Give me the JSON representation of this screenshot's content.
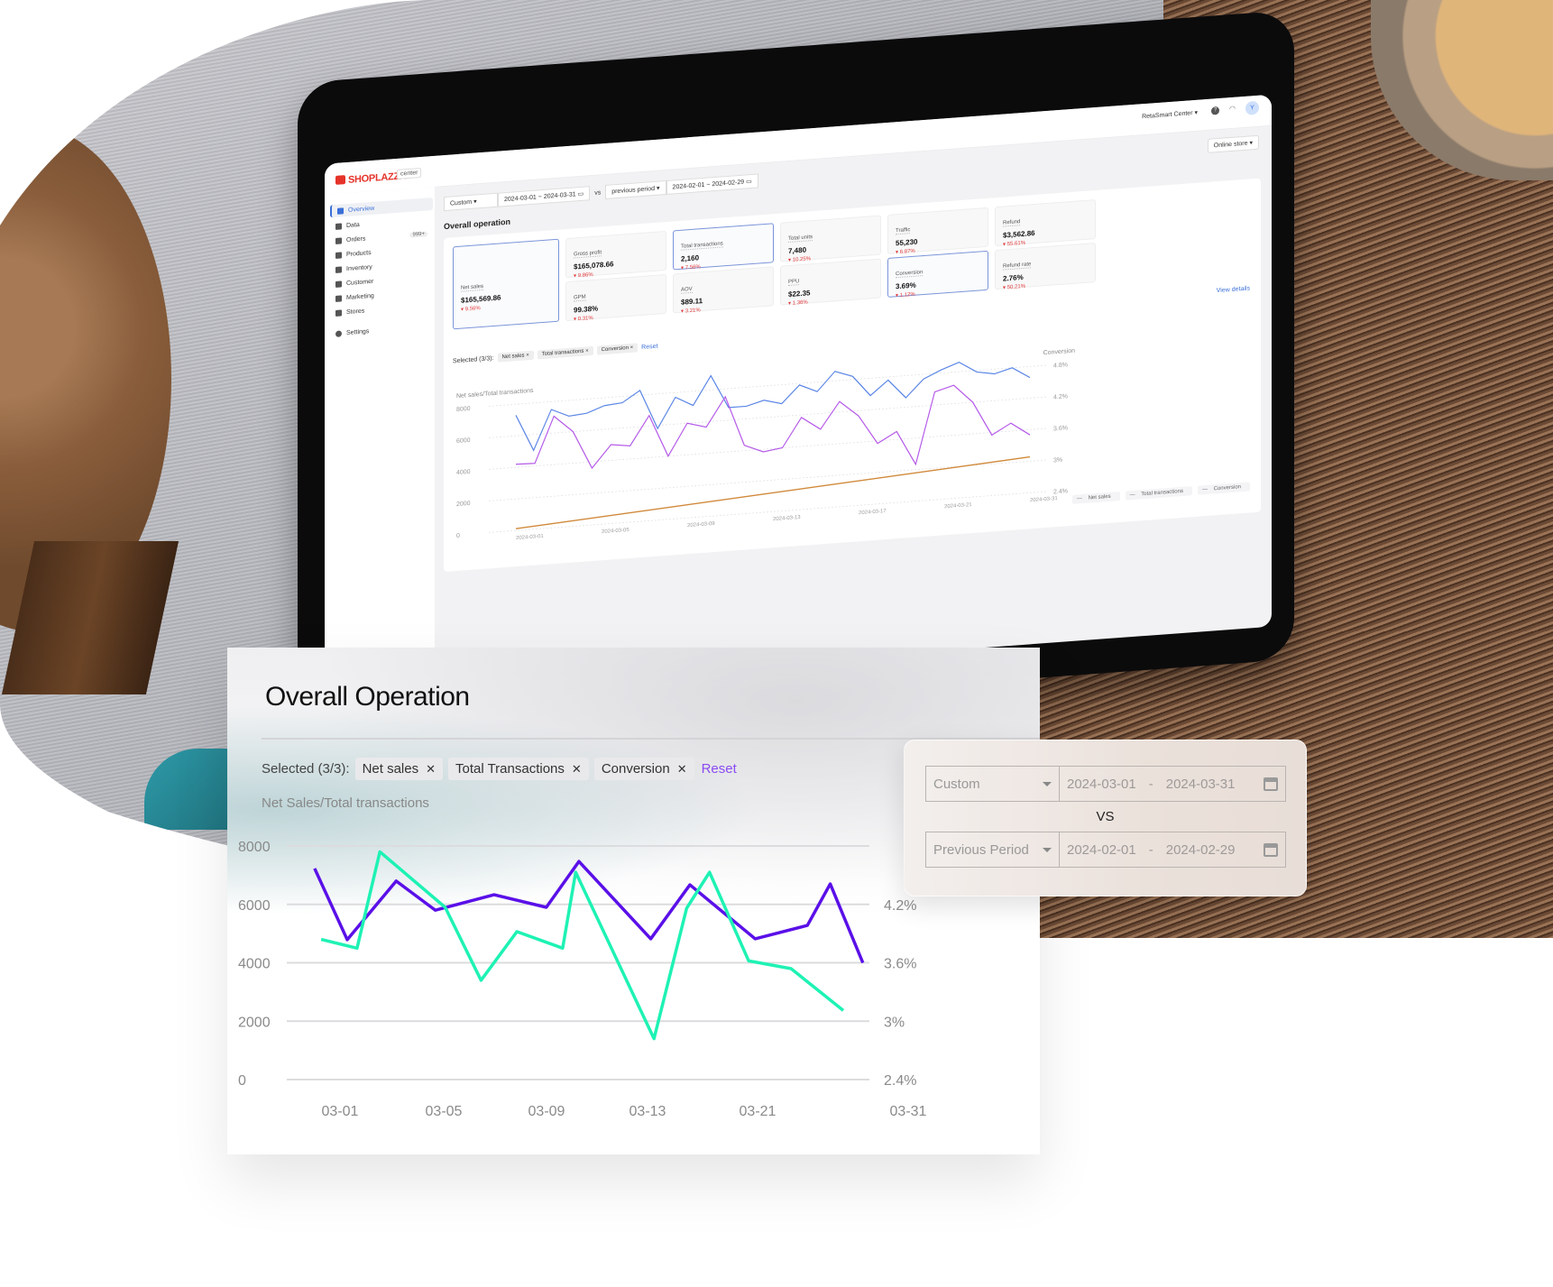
{
  "tablet": {
    "brand": "SHOPLAZZA",
    "brand_tag": "center",
    "store_name": "RetaSmart Center",
    "avatar_initial": "Y",
    "channel": "Online store",
    "sidebar": [
      {
        "label": "Overview",
        "icon": "home-icon",
        "active": true
      },
      {
        "label": "Data",
        "icon": "bar-chart-icon"
      },
      {
        "label": "Orders",
        "icon": "orders-icon",
        "badge": "999+"
      },
      {
        "label": "Products",
        "icon": "tag-icon"
      },
      {
        "label": "Inventory",
        "icon": "box-icon"
      },
      {
        "label": "Customer",
        "icon": "user-icon"
      },
      {
        "label": "Marketing",
        "icon": "marketing-icon"
      },
      {
        "label": "Stores",
        "icon": "store-icon"
      },
      {
        "label": "Settings",
        "icon": "gear-icon"
      }
    ],
    "filter": {
      "range_type": "Custom",
      "start": "2024-03-01",
      "end": "2024-03-31",
      "vs": "vs",
      "compare_type": "previous period",
      "compare_start": "2024-02-01",
      "compare_end": "2024-02-29",
      "sep": "~"
    },
    "section_title": "Overall operation",
    "metrics": [
      {
        "label": "Net sales",
        "value": "$165,569.86",
        "change": "9.56%"
      },
      {
        "label": "Gross profit",
        "value": "$165,078.66",
        "change": "9.86%"
      },
      {
        "label": "GPM",
        "value": "99.38%",
        "change": "0.31%"
      },
      {
        "label": "Total transactions",
        "value": "2,160",
        "change": "7.56%"
      },
      {
        "label": "AOV",
        "value": "$89.11",
        "change": "3.21%"
      },
      {
        "label": "Total units",
        "value": "7,480",
        "change": "10.25%"
      },
      {
        "label": "PPU",
        "value": "$22.35",
        "change": "1.36%"
      },
      {
        "label": "Traffic",
        "value": "55,230",
        "change": "6.87%"
      },
      {
        "label": "Conversion",
        "value": "3.69%",
        "change": "1.12%"
      },
      {
        "label": "Refund",
        "value": "$3,562.86",
        "change": "55.61%"
      },
      {
        "label": "Refund rate",
        "value": "2.76%",
        "change": "50.21%"
      }
    ],
    "view_details": "View details",
    "selected_label": "Selected (3/3):",
    "chips": [
      "Net sales",
      "Total transactions",
      "Conversion"
    ],
    "reset": "Reset",
    "chart_ytitle_left": "Net sales/Total transactions",
    "chart_ytitle_right": "Conversion",
    "y_left_ticks": [
      "8000",
      "6000",
      "4000",
      "2000",
      "0"
    ],
    "y_right_ticks": [
      "4.8%",
      "4.2%",
      "3.6%",
      "3%",
      "2.4%"
    ],
    "x_ticks": [
      "2024-03-01",
      "2024-03-05",
      "2024-03-09",
      "2024-03-13",
      "2024-03-17",
      "2024-03-21",
      "2024-03-31"
    ],
    "legend": [
      "Net sales",
      "Total transactions",
      "Conversion"
    ],
    "series_colors": {
      "net_sales": "#5b86e5",
      "total_transactions": "#d0893a",
      "conversion": "#b55ae8"
    },
    "net_sales": [
      7300,
      5000,
      7500,
      7000,
      7100,
      7500,
      7600,
      8300,
      5800,
      7700,
      7100,
      8900,
      6800,
      6800,
      7100,
      6800,
      7900,
      7400,
      8600,
      8200,
      6900,
      7800,
      6600,
      7700,
      8200,
      8600,
      7900,
      7700,
      8000,
      7300
    ],
    "conversion": [
      3.66,
      3.65,
      4.52,
      4.2,
      3.48,
      3.9,
      3.85,
      4.4,
      3.6,
      4.2,
      4.1,
      4.65,
      3.7,
      3.55,
      3.6,
      4.15,
      3.9,
      4.4,
      4.1,
      3.55,
      3.75,
      3.1,
      4.45,
      4.55,
      4.2,
      3.55,
      3.75,
      3.5
    ],
    "total_transactions": [
      0,
      2160
    ]
  },
  "card": {
    "title": "Overall Operation",
    "selected_label": "Selected (3/3):",
    "chips": [
      "Net sales",
      "Total Transactions",
      "Conversion"
    ],
    "reset": "Reset",
    "y_title": "Net Sales/Total transactions"
  },
  "date_panel": {
    "primary_type": "Custom",
    "primary_start": "2024-03-01",
    "primary_end": "2024-03-31",
    "vs": "VS",
    "compare_type": "Previous Period",
    "compare_start": "2024-02-01",
    "compare_end": "2024-02-29",
    "sep": "-"
  },
  "chart_data": {
    "type": "line",
    "title": "Overall Operation",
    "ylabel": "Net Sales/Total transactions",
    "y_left_range": [
      0,
      8000
    ],
    "y_left_ticks": [
      0,
      2000,
      4000,
      6000,
      8000
    ],
    "y_right_range": [
      2.4,
      4.8
    ],
    "y_right_ticks": [
      "2.4%",
      "3%",
      "3.6%",
      "4.2%"
    ],
    "x_ticks": [
      "03-01",
      "03-05",
      "03-09",
      "03-13",
      "03-21",
      "03-31"
    ],
    "grid": true,
    "series": [
      {
        "name": "Net sales",
        "color": "#5a10e8",
        "axis": "left",
        "x": [
          0,
          1,
          2.5,
          3.7,
          5.5,
          7.1,
          8.1,
          10.3,
          11.5,
          13.5,
          15.1,
          15.8,
          16.8
        ],
        "values": [
          7230,
          4790,
          6800,
          5800,
          6330,
          5900,
          7470,
          4820,
          6670,
          4820,
          5280,
          6700,
          4000
        ]
      },
      {
        "name": "Conversion",
        "color": "#1ef2b4",
        "axis": "right",
        "x": [
          0.2,
          1.3,
          2.0,
          4.0,
          5.1,
          6.2,
          7.6,
          8.0,
          10.4,
          11.4,
          12.1,
          13.3,
          14.6,
          16.2
        ],
        "values": [
          3.84,
          3.75,
          4.74,
          4.17,
          3.42,
          3.92,
          3.75,
          4.53,
          2.82,
          4.16,
          4.53,
          3.62,
          3.54,
          3.11
        ]
      }
    ],
    "x_range": [
      -0.3,
      17.0
    ]
  }
}
